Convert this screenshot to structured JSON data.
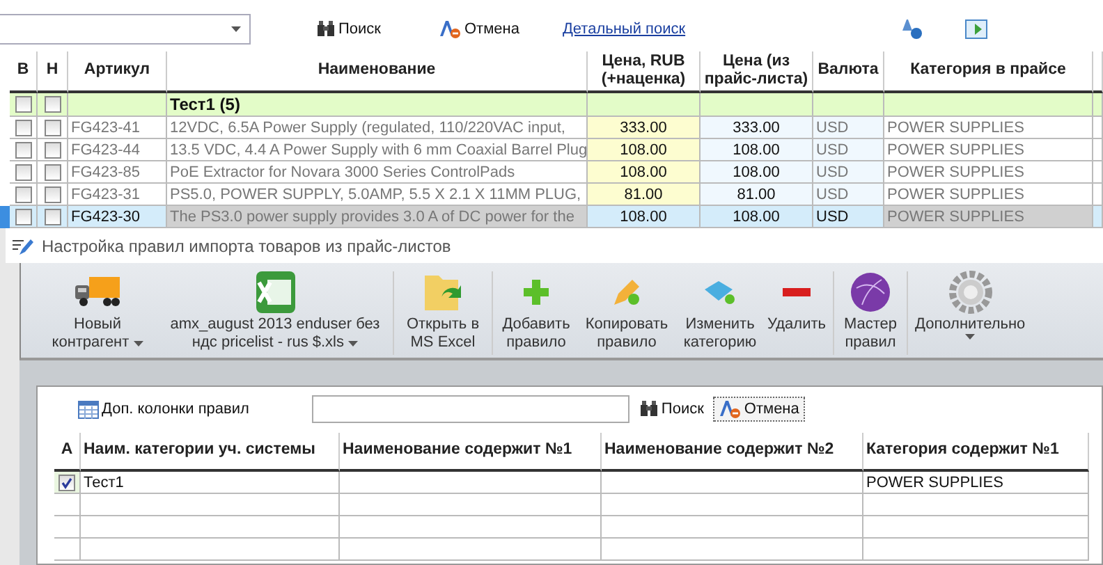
{
  "top_bar": {
    "search_button": "Поиск",
    "cancel_button": "Отмена",
    "advanced_link": "Детальный поиск"
  },
  "products_table": {
    "columns": [
      "В",
      "Н",
      "Артикул",
      "Наименование",
      "Цена, RUB (+наценка)",
      "Цена (из прайс-листа)",
      "Валюта",
      "Категория в прайсе"
    ],
    "group": {
      "label": "Тест1 (5)",
      "checked_b": false,
      "checked_n": false
    },
    "rows": [
      {
        "b": false,
        "n": false,
        "sku": "FG423-41",
        "name": "12VDC, 6.5A Power Supply (regulated, 110/220VAC input,",
        "price": "333.00",
        "list_price": "333.00",
        "currency": "USD",
        "category": "POWER SUPPLIES",
        "selected": false
      },
      {
        "b": false,
        "n": false,
        "sku": "FG423-44",
        "name": "13.5 VDC,  4.4 A Power Supply with 6 mm Coaxial Barrel Plug",
        "price": "108.00",
        "list_price": "108.00",
        "currency": "USD",
        "category": "POWER SUPPLIES",
        "selected": false
      },
      {
        "b": false,
        "n": false,
        "sku": "FG423-85",
        "name": "PoE Extractor for Novara 3000 Series ControlPads",
        "price": "108.00",
        "list_price": "108.00",
        "currency": "USD",
        "category": "POWER SUPPLIES",
        "selected": false
      },
      {
        "b": false,
        "n": false,
        "sku": "FG423-31",
        "name": "PS5.0, POWER SUPPLY, 5.0AMP, 5.5 X 2.1 X 11MM PLUG,",
        "price": "81.00",
        "list_price": "81.00",
        "currency": "USD",
        "category": "POWER SUPPLIES",
        "selected": false
      },
      {
        "b": false,
        "n": false,
        "sku": "FG423-30",
        "name": "The PS3.0 power supply provides 3.0 A of DC power for the",
        "price": "108.00",
        "list_price": "108.00",
        "currency": "USD",
        "category": "POWER SUPPLIES",
        "selected": true
      }
    ]
  },
  "dialog": {
    "title": "Настройка правил импорта товаров из прайс-листов",
    "toolbar": [
      {
        "kind": "truck",
        "label": "Новый контрагент",
        "dropdown": true,
        "separator_after": false
      },
      {
        "kind": "excel",
        "label": "amx_august 2013 enduser без ндс pricelist - rus $.xls",
        "dropdown": true,
        "separator_after": true
      },
      {
        "kind": "folder",
        "label": "Открыть в MS Excel",
        "dropdown": false,
        "separator_after": true
      },
      {
        "kind": "plus",
        "label": "Добавить правило",
        "dropdown": false,
        "separator_after": false
      },
      {
        "kind": "pencil",
        "label": "Копировать правило",
        "dropdown": false,
        "separator_after": false
      },
      {
        "kind": "tag",
        "label": "Изменить категорию",
        "dropdown": false,
        "separator_after": false
      },
      {
        "kind": "minus",
        "label": "Удалить",
        "dropdown": false,
        "separator_after": true
      },
      {
        "kind": "globe",
        "label": "Мастер правил",
        "dropdown": false,
        "separator_after": true
      },
      {
        "kind": "gear",
        "label": "Дополнительно",
        "dropdown": true,
        "separator_after": false
      }
    ],
    "extra_columns_button": "Доп. колонки правил",
    "search_button": "Поиск",
    "cancel_button": "Отмена",
    "rules_table": {
      "columns": [
        "А",
        "Наим. категории уч. системы",
        "Наименование содержит №1",
        "Наименование содержит №2",
        "Категория содержит №1"
      ],
      "rows": [
        {
          "active": true,
          "category": "Тест1",
          "name_1": "",
          "name_2": "",
          "category_1": "POWER SUPPLIES"
        }
      ]
    }
  }
}
